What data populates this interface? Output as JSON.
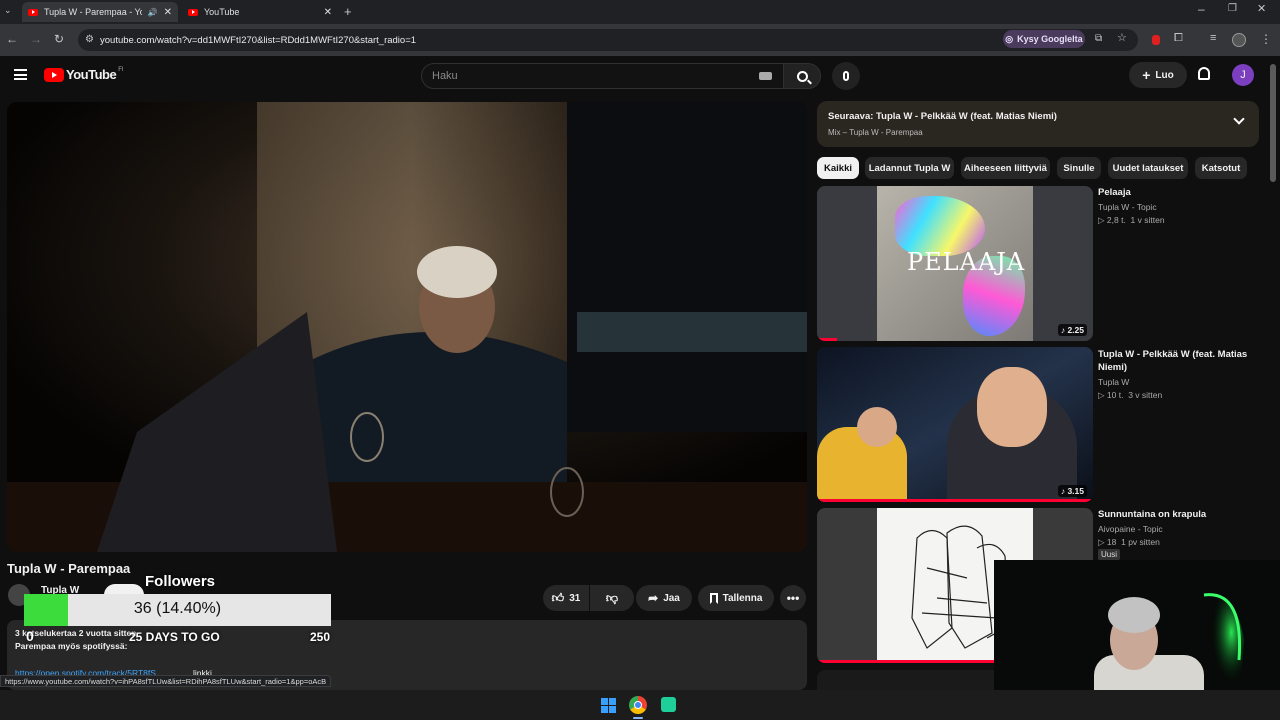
{
  "browser": {
    "tabs": [
      {
        "title": "Tupla W - Parempaa - YouTube",
        "active": true
      },
      {
        "title": "YouTube",
        "active": false
      }
    ],
    "url": "youtube.com/watch?v=dd1MWFtI270&list=RDdd1MWFtI270&start_radio=1",
    "ask_google": "Kysy Googlelta",
    "status_url": "https://www.youtube.com/watch?v=ihPA8sfTLUw&list=RDihPA8sfTLUw&start_radio=1&pp=oAcB"
  },
  "yt": {
    "logo": "YouTube",
    "region": "FI",
    "search_placeholder": "Haku",
    "create_label": "Luo",
    "avatar_letter": "J",
    "video_title": "Tupla W - Parempaa",
    "channel_name": "Tupla W",
    "like_count": "31",
    "share_label": "Jaa",
    "save_label": "Tallenna",
    "desc_line1": "3 katselukertaa  2 vuotta sitten",
    "desc_line2": "Parempaa myös spotifyssä:",
    "desc_link": "https://open.spotify.com/track/5RT8fS",
    "desc_extra": "linkki"
  },
  "playlist": {
    "next": "Seuraava: Tupla W - Pelkkää W (feat. Matias Niemi)",
    "sub": "Mix – Tupla W - Parempaa"
  },
  "chips": [
    "Kaikki",
    "Ladannut Tupla W",
    "Aiheeseen liittyviä",
    "Sinulle",
    "Uudet lataukset",
    "Katsotut"
  ],
  "recs": [
    {
      "title": "Pelaaja",
      "channel": "Tupla W - Topic",
      "views": "2,8 t.",
      "age": "1 v sitten",
      "duration": "2.25",
      "cover_text": "PELAAJA",
      "badge": ""
    },
    {
      "title": "Tupla W - Pelkkää W (feat. Matias Niemi)",
      "channel": "Tupla W",
      "views": "10 t.",
      "age": "3 v sitten",
      "duration": "3.15",
      "cover_text": "",
      "badge": ""
    },
    {
      "title": "Sunnuntaina on krapula",
      "channel": "Aivopaine - Topic",
      "views": "18",
      "age": "1 pv sitten",
      "duration": "",
      "cover_text": "",
      "badge": "Uusi"
    }
  ],
  "overlay": {
    "followers_label": "Followers",
    "progress_text": "36 (14.40%)",
    "progress_fraction": 0.144,
    "start": "0",
    "days_to_go": "25 DAYS TO GO",
    "goal": "250",
    "fill_color": "#3ddc3d"
  }
}
